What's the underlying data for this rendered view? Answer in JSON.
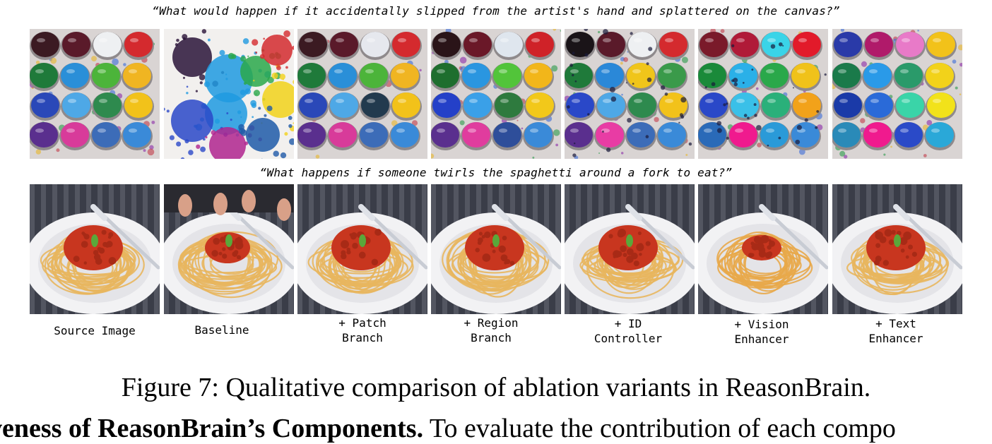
{
  "prompts": {
    "row1": "“What would happen if it accidentally slipped from the artist's hand and splattered on the canvas?”",
    "row2": "“What happens if someone twirls the spaghetti around a fork to eat?”"
  },
  "columns": [
    {
      "line1": "Source Image",
      "line2": ""
    },
    {
      "line1": "Baseline",
      "line2": ""
    },
    {
      "line1": "+ Patch",
      "line2": "Branch"
    },
    {
      "line1": "+ Region",
      "line2": "Branch"
    },
    {
      "line1": "+ ID",
      "line2": "Controller"
    },
    {
      "line1": "+ Vision",
      "line2": "Enhancer"
    },
    {
      "line1": "+ Text",
      "line2": "Enhancer"
    }
  ],
  "figure": {
    "caption": "Figure 7: Qualitative comparison of ablation variants in ReasonBrain."
  },
  "body_text": {
    "bold": "veness of ReasonBrain’s Components.",
    "rest": " To evaluate the contribution of each compo"
  },
  "colors": {
    "palette_tray": "#d9d4d3",
    "pasta": "#e8b65e",
    "sauce": "#c8361f",
    "plate": "#f2f2f4",
    "background_dark": "#3a3d48"
  },
  "images": {
    "row1": [
      "paint-palette-source",
      "paint-splatter-baseline",
      "paint-palette-patch",
      "paint-palette-region",
      "paint-palette-id",
      "paint-palette-vision",
      "paint-palette-text"
    ],
    "row2": [
      "spaghetti-source",
      "spaghetti-baseline-hands",
      "spaghetti-patch",
      "spaghetti-region",
      "spaghetti-id",
      "spaghetti-vision",
      "spaghetti-text"
    ]
  }
}
